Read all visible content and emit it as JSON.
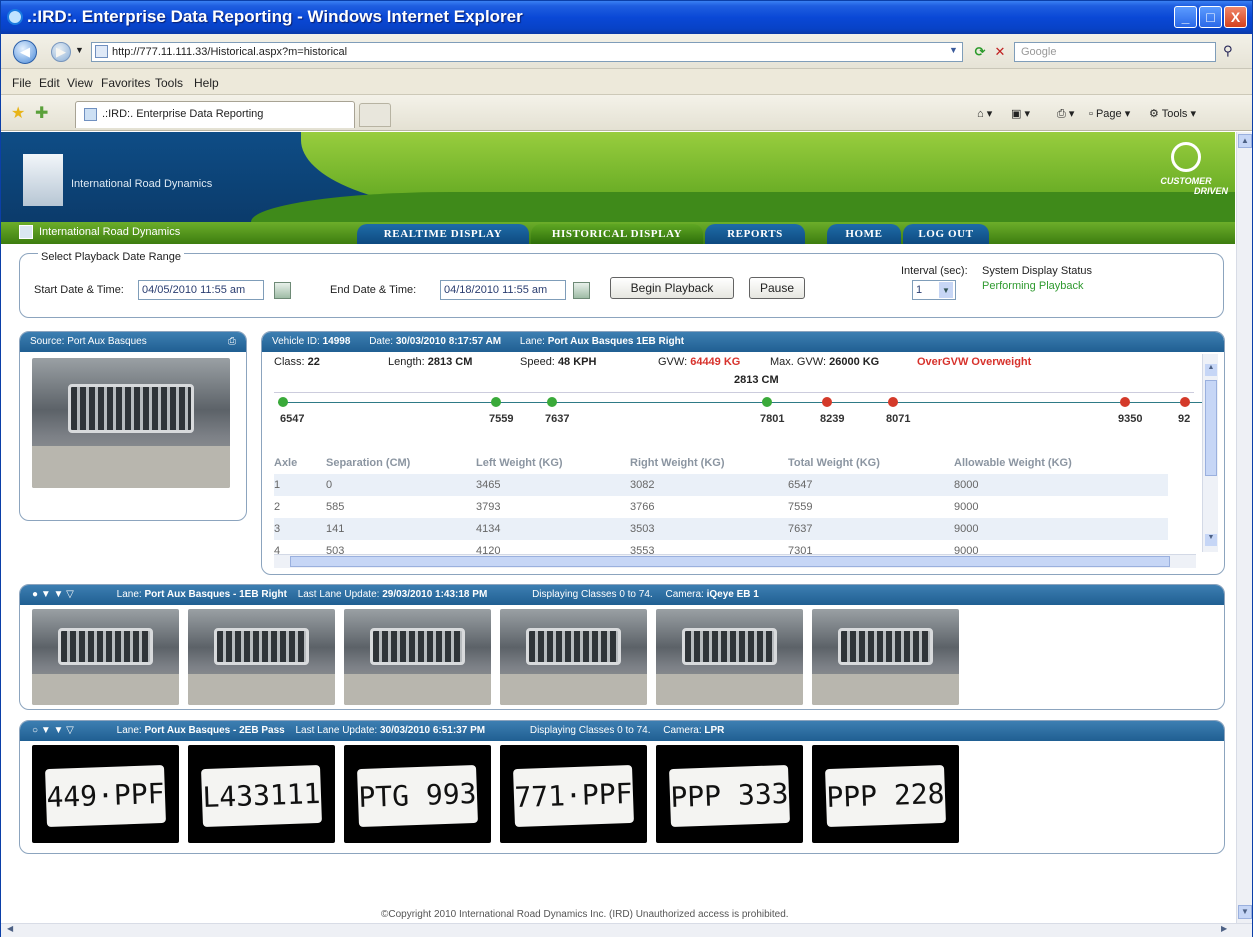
{
  "window": {
    "title": ".:IRD:. Enterprise Data Reporting - Windows Internet Explorer",
    "minimize": "_",
    "maximize": "□",
    "close": "X"
  },
  "address_bar": {
    "url": "http://777.11.111.33/Historical.aspx?m=historical",
    "search_placeholder": "Google"
  },
  "menu": [
    "File",
    "Edit",
    "View",
    "Favorites",
    "Tools",
    "Help"
  ],
  "tab": {
    "title": ".:IRD:. Enterprise Data Reporting"
  },
  "command_bar": {
    "page_label": "Page",
    "tools_label": "Tools"
  },
  "header": {
    "logo_text": "International Road Dynamics",
    "badge_line1": "CUSTOMER",
    "badge_line2": "DRIVEN"
  },
  "nav": {
    "brand": "International Road Dynamics",
    "tabs": [
      "Realtime Display",
      "Historical Display",
      "Reports",
      "Home",
      "Log Out"
    ]
  },
  "playback": {
    "legend": "Select Playback Date Range",
    "start_label": "Start Date & Time:",
    "start_value": "04/05/2010 11:55 am",
    "end_label": "End Date & Time:",
    "end_value": "04/18/2010 11:55 am",
    "begin_button": "Begin Playback",
    "pause_button": "Pause",
    "interval_label": "Interval (sec):",
    "interval_value": "1",
    "status_label": "System Display Status",
    "status_value": "Performing Playback"
  },
  "source": {
    "title": "Source: Port Aux Basques"
  },
  "vehicle": {
    "id_label": "Vehicle ID:",
    "id_value": "14998",
    "date_label": "Date:",
    "date_value": "30/03/2010 8:17:57 AM",
    "lane_label": "Lane:",
    "lane_value": "Port Aux Basques 1EB Right",
    "class_label": "Class:",
    "class_value": "22",
    "length_label": "Length:",
    "length_value": "2813 CM",
    "speed_label": "Speed:",
    "speed_value": "48 KPH",
    "gvw_label": "GVW:",
    "gvw_value": "64449 KG",
    "maxgvw_label": "Max. GVW:",
    "maxgvw_value": "26000 KG",
    "warning": "OverGVW Overweight",
    "total_length": "2813 CM",
    "axle_weights": [
      "6547",
      "7559",
      "7637",
      "7801",
      "8239",
      "8071",
      "9350",
      "92"
    ],
    "table": {
      "headers": [
        "Axle",
        "Separation (CM)",
        "Left Weight (KG)",
        "Right Weight (KG)",
        "Total Weight (KG)",
        "Allowable Weight (KG)"
      ],
      "rows": [
        [
          "1",
          "0",
          "3465",
          "3082",
          "6547",
          "8000"
        ],
        [
          "2",
          "585",
          "3793",
          "3766",
          "7559",
          "9000"
        ],
        [
          "3",
          "141",
          "4134",
          "3503",
          "7637",
          "9000"
        ],
        [
          "4",
          "503",
          "4120",
          "3553",
          "7301",
          "9000"
        ]
      ]
    }
  },
  "lane1": {
    "lane_label": "Lane:",
    "lane_value": "Port Aux Basques - 1EB Right",
    "update_label": "Last Lane Update:",
    "update_value": "29/03/2010 1:43:18 PM",
    "classes_value": "Displaying Classes 0 to 74.",
    "camera_label": "Camera:",
    "camera_value": "iQeye EB 1"
  },
  "lane2": {
    "lane_label": "Lane:",
    "lane_value": "Port Aux Basques - 2EB Pass",
    "update_label": "Last Lane Update:",
    "update_value": "30/03/2010 6:51:37 PM",
    "classes_value": "Displaying Classes 0 to 74.",
    "camera_label": "Camera:",
    "camera_value": "LPR",
    "plates": [
      "449·PPF",
      "L433111",
      "PTG 993",
      "771·PPF",
      "PPP 333",
      "PPP 228"
    ]
  },
  "footer": {
    "text": "©Copyright 2010 International Road Dynamics Inc. (IRD) Unauthorized access is prohibited."
  },
  "colors": {
    "title_blue": "#0a48d6",
    "header_navy": "#0e4d86",
    "header_green": "#6cae2a",
    "warning_red": "#d7322c",
    "status_green": "#2f9a2f"
  }
}
